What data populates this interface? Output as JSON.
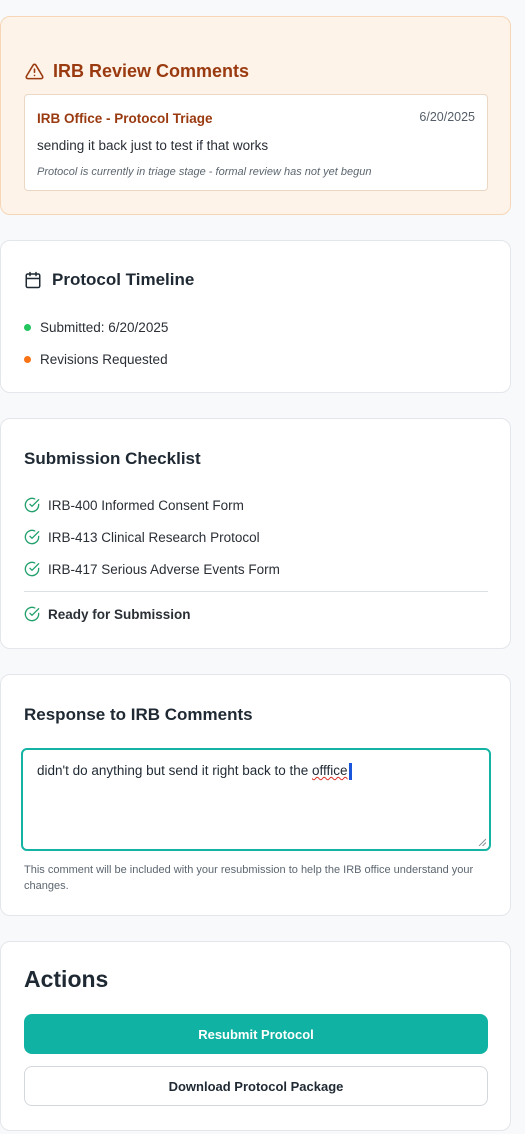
{
  "review": {
    "title": "IRB Review Comments",
    "comment": {
      "author": "IRB Office - Protocol Triage",
      "date": "6/20/2025",
      "text": "sending it back just to test if that works",
      "note": "Protocol is currently in triage stage - formal review has not yet begun"
    },
    "accent_color": "#9a3a10",
    "background_color": "#fef3e8"
  },
  "timeline": {
    "title": "Protocol Timeline",
    "items": [
      {
        "label": "Submitted: 6/20/2025",
        "color": "#22c55e"
      },
      {
        "label": "Revisions Requested",
        "color": "#f97316"
      }
    ]
  },
  "checklist": {
    "title": "Submission Checklist",
    "items": [
      {
        "label": "IRB-400 Informed Consent Form"
      },
      {
        "label": "IRB-413 Clinical Research Protocol"
      },
      {
        "label": "IRB-417 Serious Adverse Events Form"
      }
    ],
    "ready_label": "Ready for Submission",
    "check_color": "#22a06b"
  },
  "response": {
    "title": "Response to IRB Comments",
    "value_before": "didn't do anything but send it right back to the ",
    "value_misspelled": "offfice",
    "help": "This comment will be included with your resubmission to help the IRB office understand your changes.",
    "focus_color": "#14b3a3"
  },
  "actions": {
    "title": "Actions",
    "resubmit_label": "Resubmit Protocol",
    "download_label": "Download Protocol Package",
    "primary_color": "#10b3a3"
  }
}
